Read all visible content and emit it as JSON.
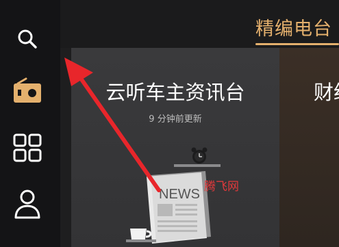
{
  "sidebar": {
    "items": [
      {
        "icon": "search-icon"
      },
      {
        "icon": "radio-icon",
        "active_color": "#e4b06d"
      },
      {
        "icon": "grid-apps-icon"
      },
      {
        "icon": "user-profile-icon"
      }
    ]
  },
  "tabs": {
    "active_label": "精编电台"
  },
  "cards": [
    {
      "title": "云听车主资讯台",
      "subtitle": "9 分钟前更新",
      "illustration_text": "NEWS"
    },
    {
      "title": "财经"
    }
  ],
  "watermark": "腾飞网",
  "colors": {
    "accent": "#e4b06d",
    "annotation_arrow": "#e8262b"
  }
}
